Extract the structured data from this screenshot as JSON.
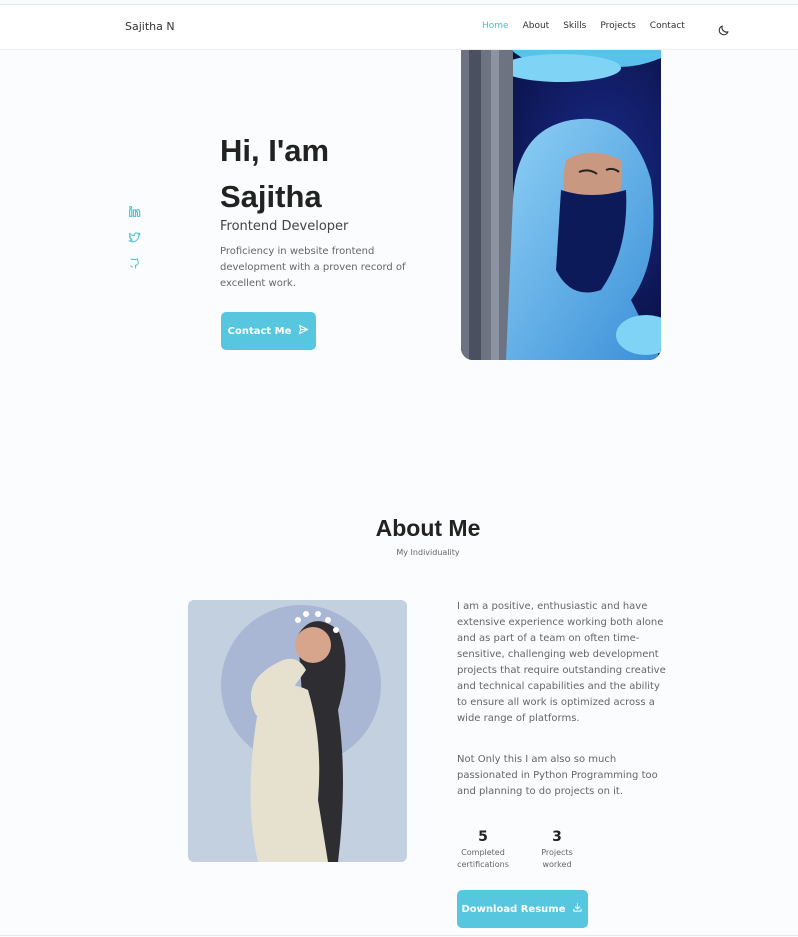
{
  "header": {
    "logo": "Sajitha N",
    "nav": [
      "Home",
      "About",
      "Skills",
      "Projects",
      "Contact"
    ],
    "active": "Home"
  },
  "hero": {
    "title_line1": "Hi, I'am",
    "title_line2": "Sajitha",
    "subtitle": "Frontend Developer",
    "description": "Proficiency in website frontend development with a proven record of excellent work.",
    "button": "Contact Me",
    "socials": [
      "linkedin-icon",
      "twitter-icon",
      "github-icon"
    ]
  },
  "about": {
    "title": "About Me",
    "subtitle": "My Individuality",
    "paragraph1": "I am a positive, enthusiastic and have extensive experience working both alone and as part of a team on often time-sensitive, challenging web development projects that require outstanding creative and technical capabilities and the ability to ensure all work is optimized across a wide range of platforms.",
    "paragraph2": "Not Only this I am also so much passionated in Python Programming too and planning to do projects on it.",
    "stats": [
      {
        "number": "5",
        "label_line1": "Completed",
        "label_line2": "certifications"
      },
      {
        "number": "3",
        "label_line1": "Projects",
        "label_line2": "worked"
      }
    ],
    "button": "Download Resume"
  },
  "colors": {
    "accent": "#56c7df",
    "active_nav": "#4bbfd8",
    "background": "#fafcfd"
  }
}
